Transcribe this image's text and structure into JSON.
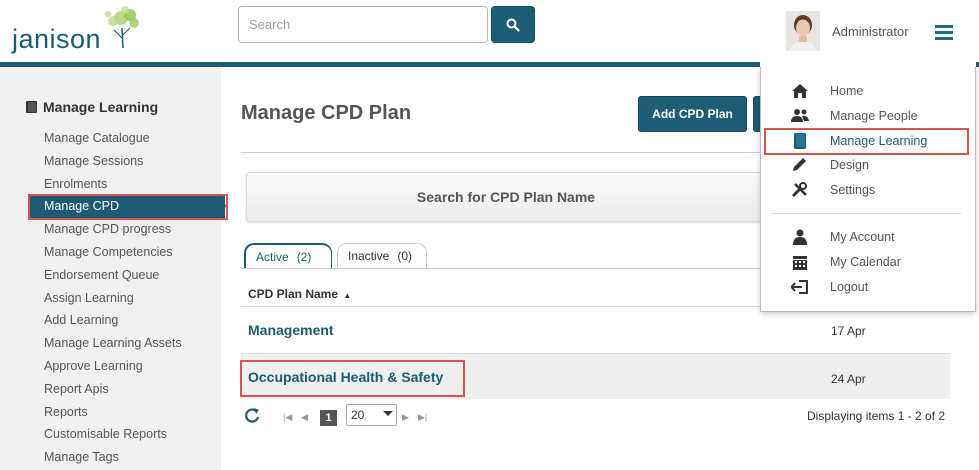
{
  "header": {
    "logo_text": "janison",
    "search_placeholder": "Search",
    "username": "Administrator"
  },
  "sidebar": {
    "heading": "Manage Learning",
    "items": [
      "Manage Catalogue",
      "Manage Sessions",
      "Enrolments",
      "Manage CPD",
      "Manage CPD progress",
      "Manage Competencies",
      "Endorsement Queue",
      "Assign Learning",
      "Add Learning",
      "Manage Learning Assets",
      "Approve Learning",
      "Report Apis",
      "Reports",
      "Customisable Reports",
      "Manage Tags"
    ],
    "active_index": 3
  },
  "main": {
    "title": "Manage CPD Plan",
    "add_button": "Add CPD Plan",
    "search_panel": "Search for CPD Plan Name",
    "tabs": [
      {
        "label": "Active",
        "count": "(2)"
      },
      {
        "label": "Inactive",
        "count": "(0)"
      }
    ],
    "column_header": "CPD Plan Name",
    "rows": [
      {
        "name": "Management",
        "date": "17 Apr"
      },
      {
        "name": "Occupational Health & Safety",
        "date": "24 Apr"
      }
    ],
    "pager": {
      "current_page": "1",
      "page_size": "20",
      "info": "Displaying items 1 - 2 of 2"
    }
  },
  "dropdown": {
    "items": [
      {
        "label": "Home",
        "icon": "home-icon"
      },
      {
        "label": "Manage People",
        "icon": "people-icon"
      },
      {
        "label": "Manage Learning",
        "icon": "book-icon"
      },
      {
        "label": "Design",
        "icon": "pencil-icon"
      },
      {
        "label": "Settings",
        "icon": "tools-icon"
      },
      {
        "label": "My Account",
        "icon": "user-icon"
      },
      {
        "label": "My Calendar",
        "icon": "calendar-icon"
      },
      {
        "label": "Logout",
        "icon": "logout-icon"
      }
    ]
  },
  "colors": {
    "brand": "#1c5b73",
    "highlight": "#d9534f"
  }
}
